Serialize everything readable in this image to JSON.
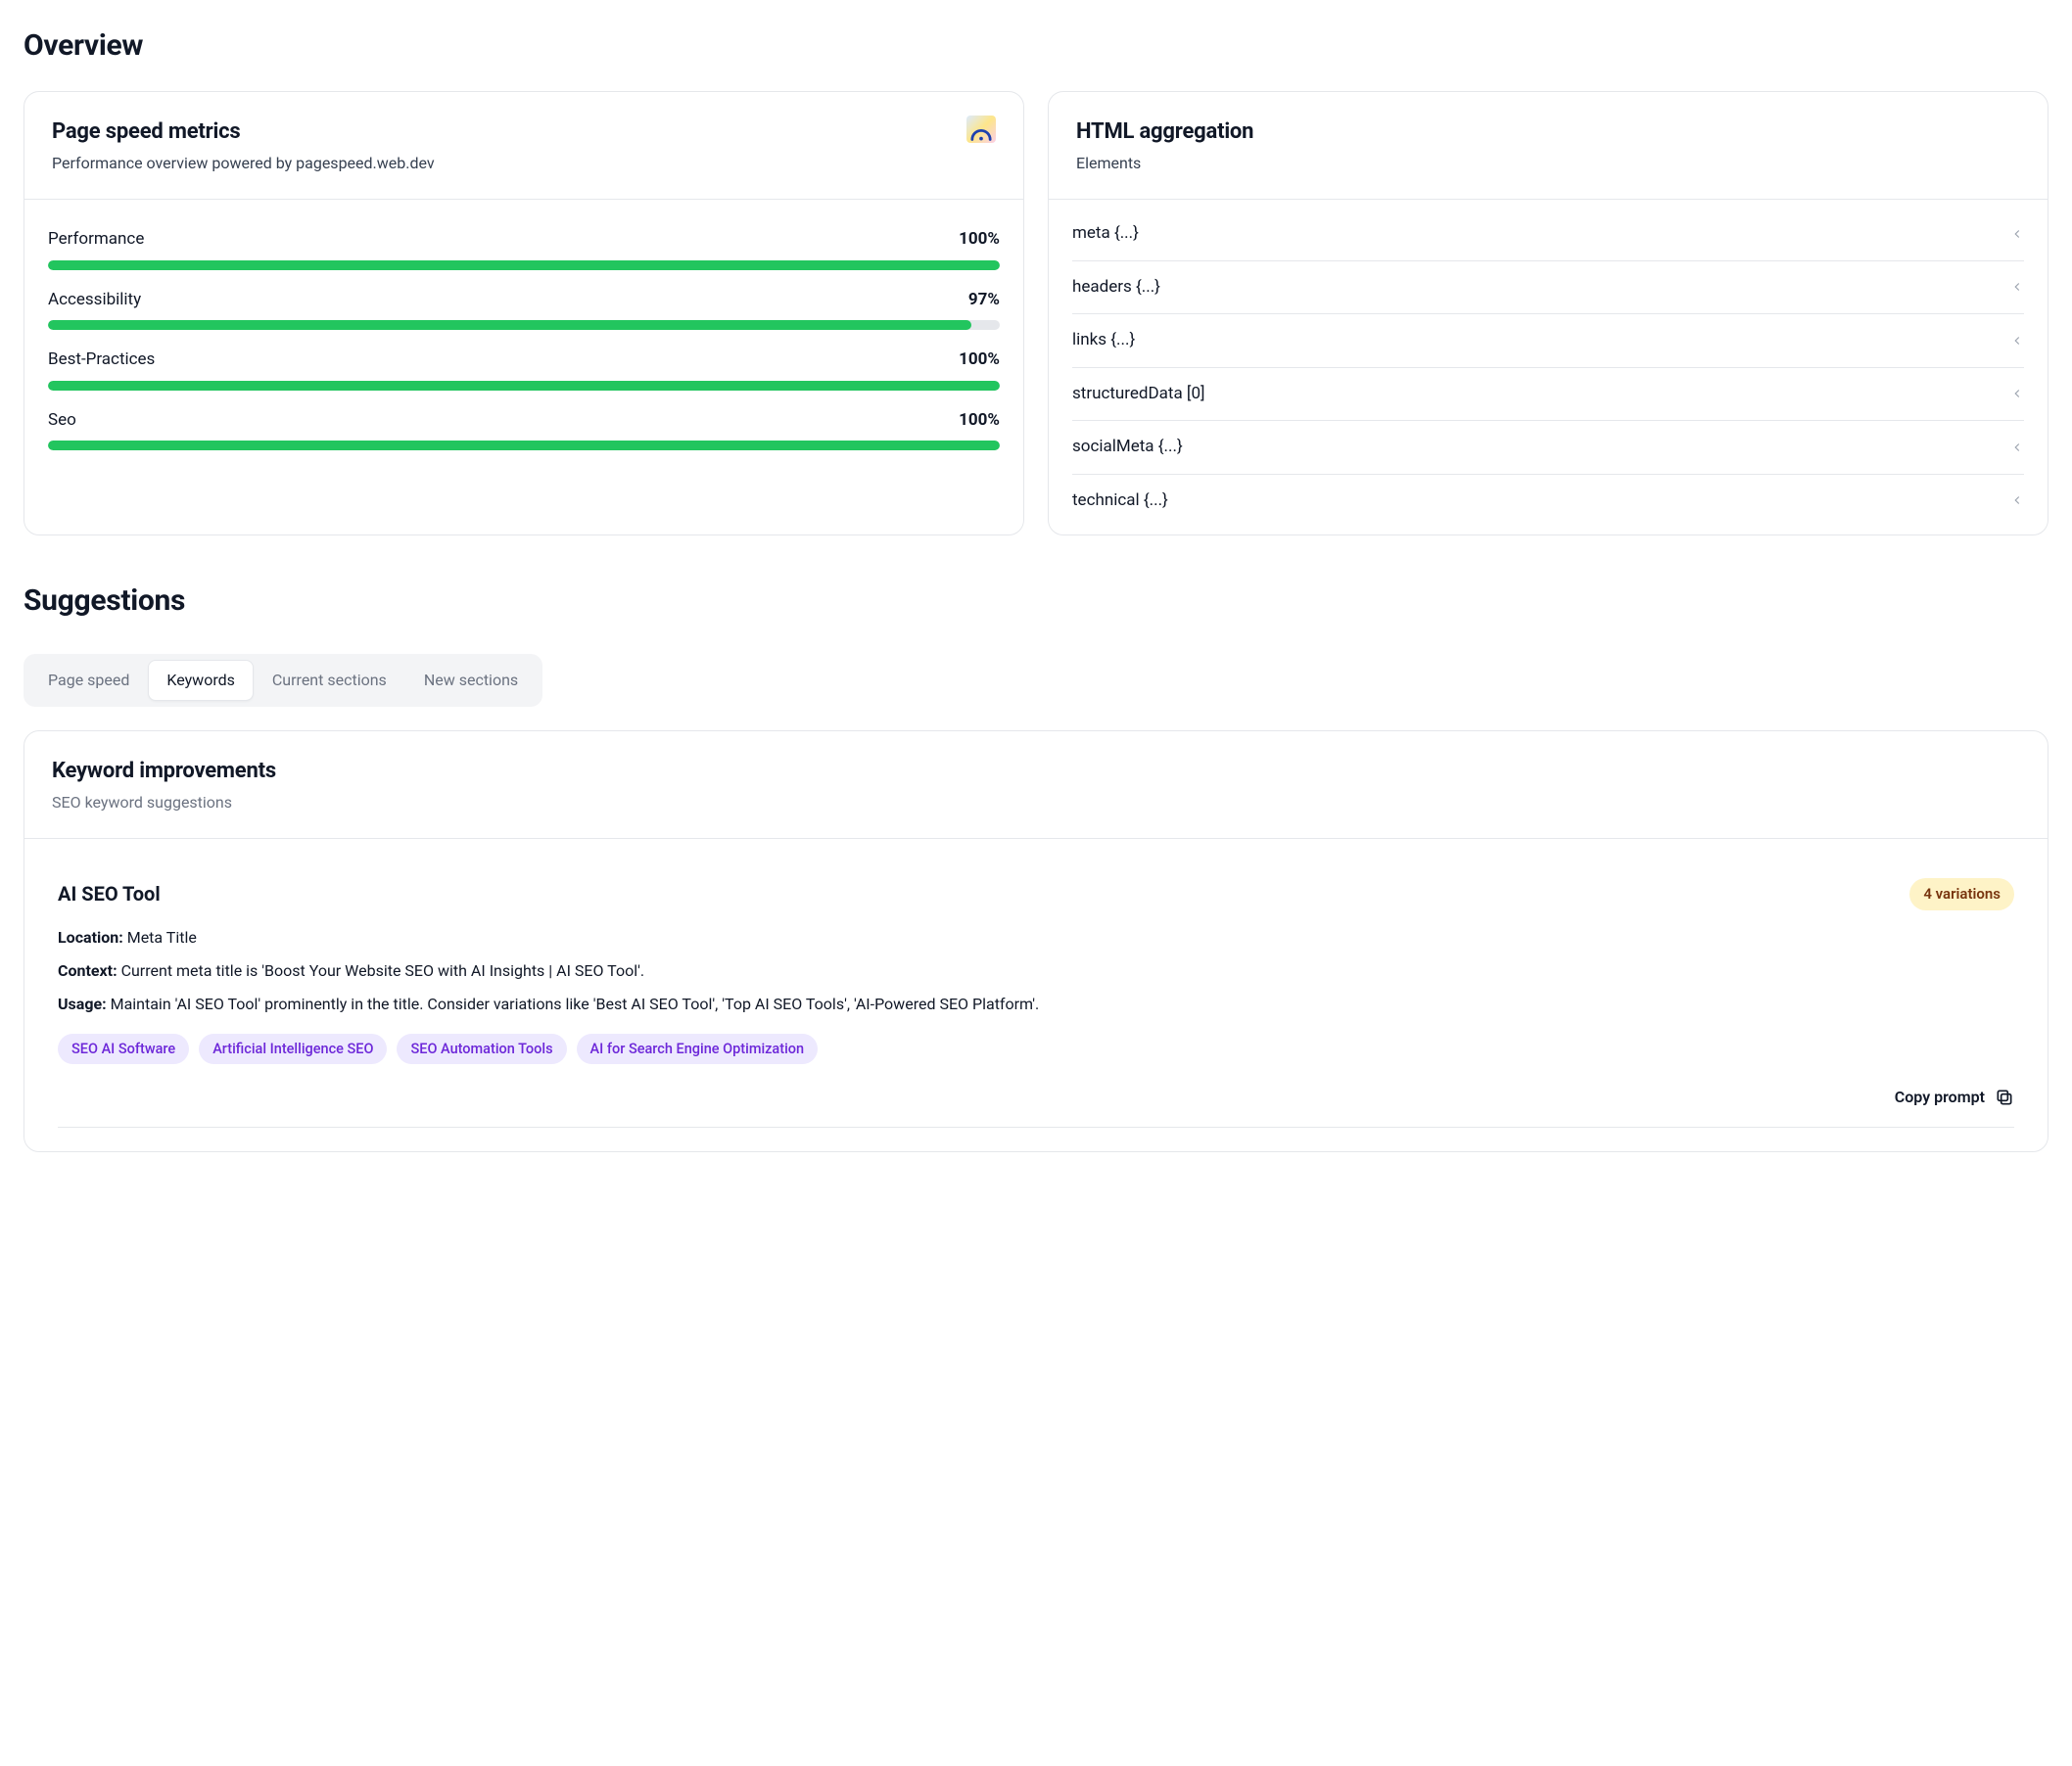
{
  "overview": {
    "title": "Overview",
    "pageSpeed": {
      "title": "Page speed metrics",
      "subtitle": "Performance overview powered by pagespeed.web.dev",
      "color": "#22c55e",
      "metrics": [
        {
          "label": "Performance",
          "value": "100%",
          "pct": 100
        },
        {
          "label": "Accessibility",
          "value": "97%",
          "pct": 97
        },
        {
          "label": "Best-Practices",
          "value": "100%",
          "pct": 100
        },
        {
          "label": "Seo",
          "value": "100%",
          "pct": 100
        }
      ]
    },
    "htmlAgg": {
      "title": "HTML aggregation",
      "subtitle": "Elements",
      "items": [
        "meta {...}",
        "headers {...}",
        "links {...}",
        "structuredData [0]",
        "socialMeta {...}",
        "technical {...}"
      ]
    }
  },
  "suggestions": {
    "title": "Suggestions",
    "tabs": [
      {
        "label": "Page speed",
        "active": false
      },
      {
        "label": "Keywords",
        "active": true
      },
      {
        "label": "Current sections",
        "active": false
      },
      {
        "label": "New sections",
        "active": false
      }
    ],
    "keywordCard": {
      "title": "Keyword improvements",
      "subtitle": "SEO keyword suggestions",
      "item": {
        "name": "AI SEO Tool",
        "badge": "4 variations",
        "locationLabel": "Location:",
        "locationValue": "Meta Title",
        "contextLabel": "Context:",
        "contextValue": "Current meta title is 'Boost Your Website SEO with AI Insights | AI SEO Tool'.",
        "usageLabel": "Usage:",
        "usageValue": "Maintain 'AI SEO Tool' prominently in the title. Consider variations like 'Best AI SEO Tool', 'Top AI SEO Tools', 'AI-Powered SEO Platform'.",
        "chips": [
          "SEO AI Software",
          "Artificial Intelligence SEO",
          "SEO Automation Tools",
          "AI for Search Engine Optimization"
        ],
        "copyLabel": "Copy prompt"
      }
    }
  }
}
